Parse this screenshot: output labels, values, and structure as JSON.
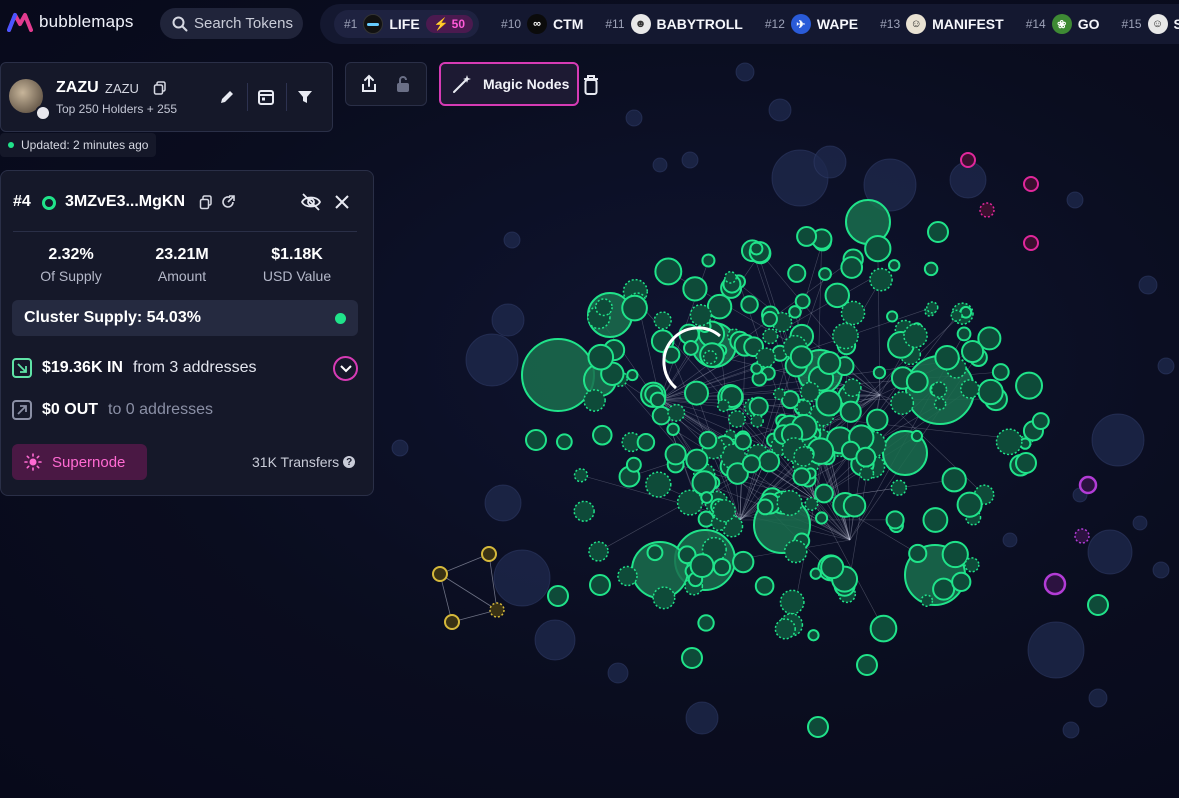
{
  "brand": {
    "name": "bubblemaps"
  },
  "search": {
    "label": "Search Tokens"
  },
  "ticker": [
    {
      "rank": "#1",
      "name": "LIFE",
      "boost": "50",
      "icon_bg": "#111",
      "icon_fg": "#6cf"
    },
    {
      "rank": "#10",
      "name": "CTM",
      "icon_bg": "#0b0b0b",
      "icon_fg": "#fff"
    },
    {
      "rank": "#11",
      "name": "BABYTROLL",
      "icon_bg": "#e8e8e8",
      "icon_fg": "#333"
    },
    {
      "rank": "#12",
      "name": "WAPE",
      "icon_bg": "#2a5bd8",
      "icon_fg": "#fff"
    },
    {
      "rank": "#13",
      "name": "MANIFEST",
      "icon_bg": "#e9e2d3",
      "icon_fg": "#222"
    },
    {
      "rank": "#14",
      "name": "GO",
      "icon_bg": "#3e8a34",
      "icon_fg": "#fff"
    },
    {
      "rank": "#15",
      "name": "S",
      "icon_bg": "#e8e8e8",
      "icon_fg": "#222"
    }
  ],
  "token": {
    "name": "ZAZU",
    "symbol": "ZAZU",
    "subtitle": "Top 250 Holders + 255",
    "updated": "Updated: 2 minutes ago"
  },
  "toolbar": {
    "magic_label": "Magic Nodes"
  },
  "detail": {
    "rank": "#4",
    "address": "3MZvE3...MgKN",
    "stats": [
      {
        "value": "2.32%",
        "label": "Of Supply"
      },
      {
        "value": "23.21M",
        "label": "Amount"
      },
      {
        "value": "$1.18K",
        "label": "USD Value"
      }
    ],
    "cluster_supply": "Cluster Supply: 54.03%",
    "inflow": {
      "value": "$19.36K IN",
      "label": "from 3 addresses"
    },
    "outflow": {
      "value": "$0 OUT",
      "label": "to 0 addresses"
    },
    "supernode_label": "Supernode",
    "transfers": "31K Transfers"
  },
  "colors": {
    "accent": "#d63bb5",
    "node_green": "#20e38a",
    "node_pink": "#e0279b",
    "node_purple": "#b23cd6",
    "node_yellow": "#d6b93b",
    "node_idle": "#1f2a4e"
  },
  "icons": {
    "search": "search-icon",
    "copy": "copy-icon",
    "edit": "pencil-icon",
    "calendar": "calendar-icon",
    "filter": "filter-icon",
    "share": "share-icon",
    "lock": "lock-icon",
    "magic": "magic-wand-icon",
    "trash": "trash-icon",
    "hide": "eye-off-icon",
    "close": "close-icon",
    "refresh": "refresh-icon",
    "in": "arrow-in-icon",
    "out": "arrow-out-icon",
    "chevron": "chevron-down-icon",
    "sun": "sun-icon"
  }
}
